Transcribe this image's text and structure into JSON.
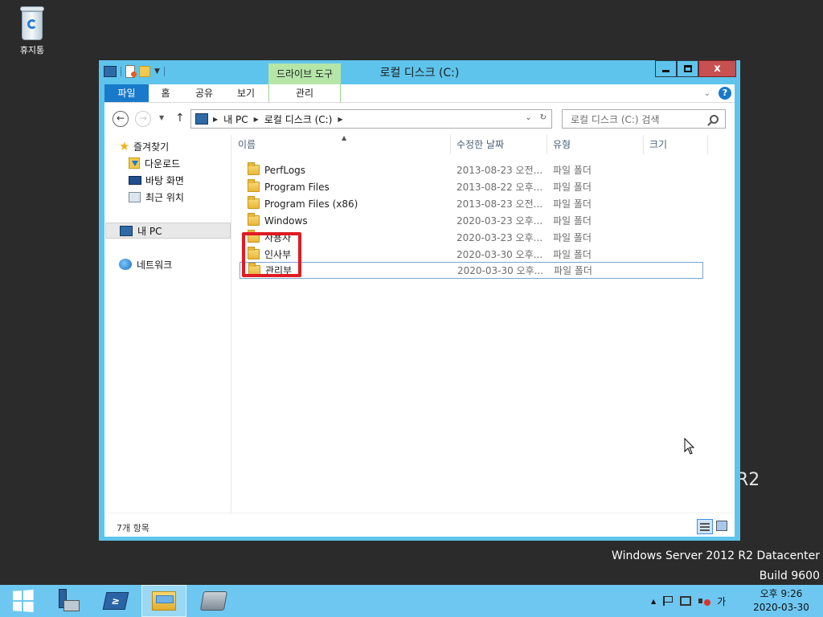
{
  "desktop": {
    "recycle_bin_label": "휴지통",
    "brand_line1": "Windows Server 2012 R2 Datacenter",
    "brand_line2": "Build 9600",
    "watermark": "R2"
  },
  "window": {
    "title": "로컬 디스크 (C:)",
    "tool_tab_header": "드라이브 도구",
    "close_glyph": "x",
    "ribbon_tabs": [
      {
        "label": "파일"
      },
      {
        "label": "홈"
      },
      {
        "label": "공유"
      },
      {
        "label": "보기"
      },
      {
        "label": "관리"
      }
    ],
    "help_glyph": "?"
  },
  "address": {
    "crumbs": [
      "내 PC",
      "로컬 디스크 (C:)"
    ],
    "search_placeholder": "로컬 디스크 (C:) 검색"
  },
  "nav": {
    "favorites": "즐겨찾기",
    "downloads": "다운로드",
    "desktop": "바탕 화면",
    "recent": "최근 위치",
    "this_pc": "내 PC",
    "network": "네트워크"
  },
  "columns": {
    "name": "이름",
    "date": "수정한 날짜",
    "type": "유형",
    "size": "크기"
  },
  "files": [
    {
      "name": "PerfLogs",
      "date": "2013-08-23 오전...",
      "type": "파일 폴더"
    },
    {
      "name": "Program Files",
      "date": "2013-08-22 오후...",
      "type": "파일 폴더"
    },
    {
      "name": "Program Files (x86)",
      "date": "2013-08-23 오전...",
      "type": "파일 폴더"
    },
    {
      "name": "Windows",
      "date": "2020-03-23 오후...",
      "type": "파일 폴더"
    },
    {
      "name": "사용자",
      "date": "2020-03-23 오후...",
      "type": "파일 폴더"
    },
    {
      "name": "인사부",
      "date": "2020-03-30 오후...",
      "type": "파일 폴더"
    },
    {
      "name": "관리부",
      "date": "2020-03-30 오후...",
      "type": "파일 폴더"
    }
  ],
  "status": {
    "item_count": "7개 항목"
  },
  "taskbar": {
    "ime": "가",
    "time": "오후 9:26",
    "date": "2020-03-30",
    "powershell_glyph": "≥"
  },
  "colors": {
    "window_frame": "#5ec4ec",
    "file_tab": "#1979ca",
    "tool_tab": "#b5e6a8",
    "highlight_box": "#e01b24",
    "taskbar": "#6ec7f0"
  }
}
